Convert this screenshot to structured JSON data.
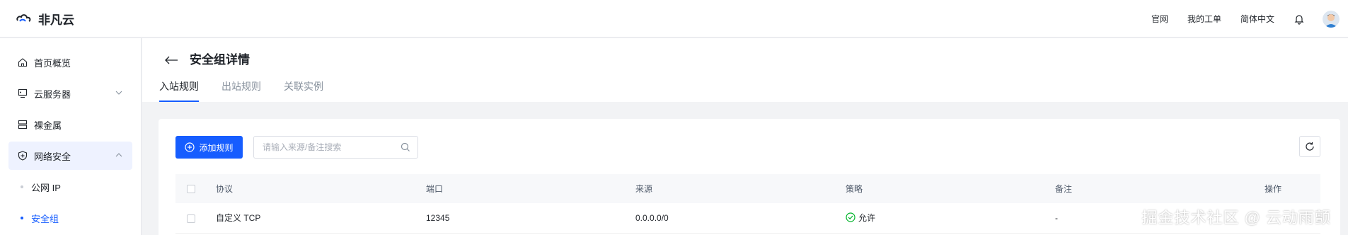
{
  "app": {
    "name": "非凡云"
  },
  "topnav": {
    "items": [
      "官网",
      "我的工单",
      "简体中文"
    ]
  },
  "sidebar": {
    "items": [
      {
        "label": "首页概览",
        "icon": "home-icon"
      },
      {
        "label": "云服务器",
        "icon": "server-icon",
        "expandable": true
      },
      {
        "label": "裸金属",
        "icon": "bare-metal-icon"
      },
      {
        "label": "网络安全",
        "icon": "shield-icon",
        "expandable": true,
        "expanded": true
      }
    ],
    "sub_items": [
      {
        "label": "公网 IP"
      },
      {
        "label": "安全组"
      }
    ]
  },
  "page": {
    "title": "安全组详情",
    "tabs": [
      "入站规则",
      "出站规则",
      "关联实例"
    ],
    "active_tab": "入站规则"
  },
  "toolbar": {
    "add_label": "添加规则",
    "search_placeholder": "请输入来源/备注搜索"
  },
  "table": {
    "headers": [
      "协议",
      "端口",
      "来源",
      "策略",
      "备注",
      "操作"
    ],
    "rows": [
      {
        "protocol": "自定义 TCP",
        "port": "12345",
        "source": "0.0.0.0/0",
        "policy": "允许",
        "note": "-"
      }
    ]
  },
  "watermark": "掘金技术社区 @ 云动雨颤",
  "colors": {
    "accent": "#165dff",
    "allow": "#00b42a"
  }
}
